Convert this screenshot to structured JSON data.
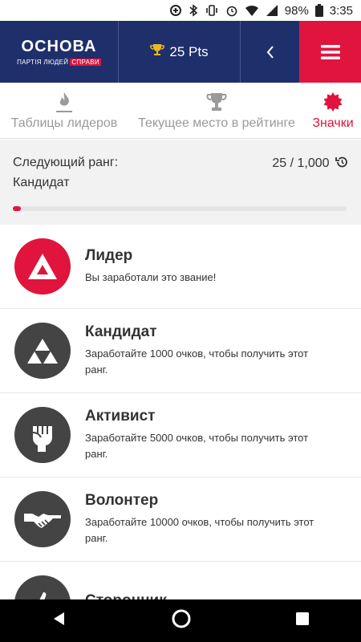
{
  "status": {
    "battery": "98%",
    "time": "3:35"
  },
  "header": {
    "logo_main": "ОСНОВА",
    "logo_sub": "ПАРТІЯ ЛЮДЕЙ",
    "logo_sub_red": "СПРАВИ",
    "points": "25 Pts"
  },
  "tabs": [
    {
      "label": "Таблицы лидеров",
      "icon": "flame-icon"
    },
    {
      "label": "Текущее место в рейтинге",
      "icon": "trophy-icon"
    },
    {
      "label": "Значки",
      "icon": "badge-icon",
      "active": true
    }
  ],
  "rank": {
    "next_label": "Следующий ранг:",
    "next_name": "Кандидат",
    "progress_text": "25 / 1,000",
    "progress_fraction": 0.025
  },
  "ranks": [
    {
      "title": "Лидер",
      "desc": "Вы заработали это звание!",
      "icon": "triangle-icon"
    },
    {
      "title": "Кандидат",
      "desc": "Заработайте 1000 очков, чтобы получить этот ранг.",
      "icon": "triangles-icon"
    },
    {
      "title": "Активист",
      "desc": "Заработайте 5000 очков, чтобы получить этот ранг.",
      "icon": "fist-icon"
    },
    {
      "title": "Волонтер",
      "desc": "Заработайте 10000 очков, чтобы получить этот ранг.",
      "icon": "handshake-icon"
    },
    {
      "title": "Сторонник",
      "desc": "",
      "icon": "thumbs-up-icon"
    }
  ],
  "colors": {
    "brand_blue": "#1f2f6b",
    "accent_red": "#e0143c",
    "badge_gray": "#444444"
  }
}
